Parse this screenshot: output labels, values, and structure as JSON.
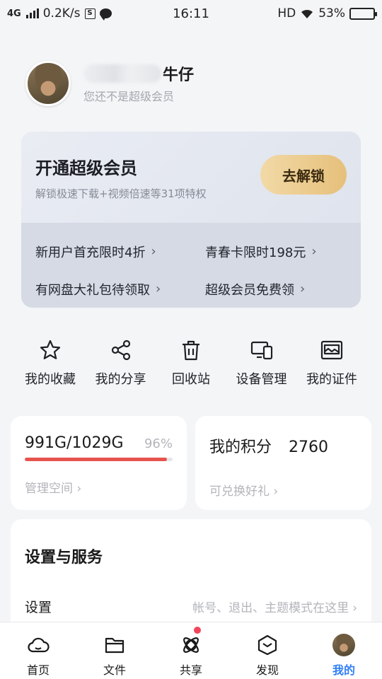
{
  "status_bar": {
    "network": "4G",
    "speed": "0.2K/s",
    "s_badge": "S",
    "time": "16:11",
    "hd": "HD",
    "battery": "53%"
  },
  "profile": {
    "name": "牛仔",
    "subtitle": "您还不是超级会员"
  },
  "vip_card": {
    "title": "开通超级会员",
    "subtitle": "解锁极速下载+视频倍速等31项特权",
    "unlock_label": "去解锁",
    "links": [
      {
        "label": "新用户首充限时4折"
      },
      {
        "label": "青春卡限时198元"
      },
      {
        "label": "有网盘大礼包待领取"
      },
      {
        "label": "超级会员免费领"
      }
    ]
  },
  "actions": [
    {
      "label": "我的收藏",
      "icon": "star-icon"
    },
    {
      "label": "我的分享",
      "icon": "share-icon"
    },
    {
      "label": "回收站",
      "icon": "trash-icon"
    },
    {
      "label": "设备管理",
      "icon": "devices-icon"
    },
    {
      "label": "我的证件",
      "icon": "id-card-icon"
    }
  ],
  "storage": {
    "used": "991G/1029G",
    "percent": "96%",
    "fill_fraction": 0.96,
    "link": "管理空间"
  },
  "points": {
    "label": "我的积分",
    "value": "2760",
    "link": "可兑换好礼"
  },
  "settings": {
    "title": "设置与服务",
    "row_label": "设置",
    "row_hint": "帐号、退出、主题模式在这里"
  },
  "tabs": [
    {
      "label": "首页",
      "icon": "cloud-icon"
    },
    {
      "label": "文件",
      "icon": "folder-icon"
    },
    {
      "label": "共享",
      "icon": "orbit-icon"
    },
    {
      "label": "发现",
      "icon": "cube-icon"
    },
    {
      "label": "我的",
      "icon": "avatar"
    }
  ],
  "colors": {
    "accent_blue": "#2f7ef6",
    "storage_red": "#e8534d",
    "unlock_gold": "#e6c07b",
    "badge_red": "#f2455a"
  }
}
